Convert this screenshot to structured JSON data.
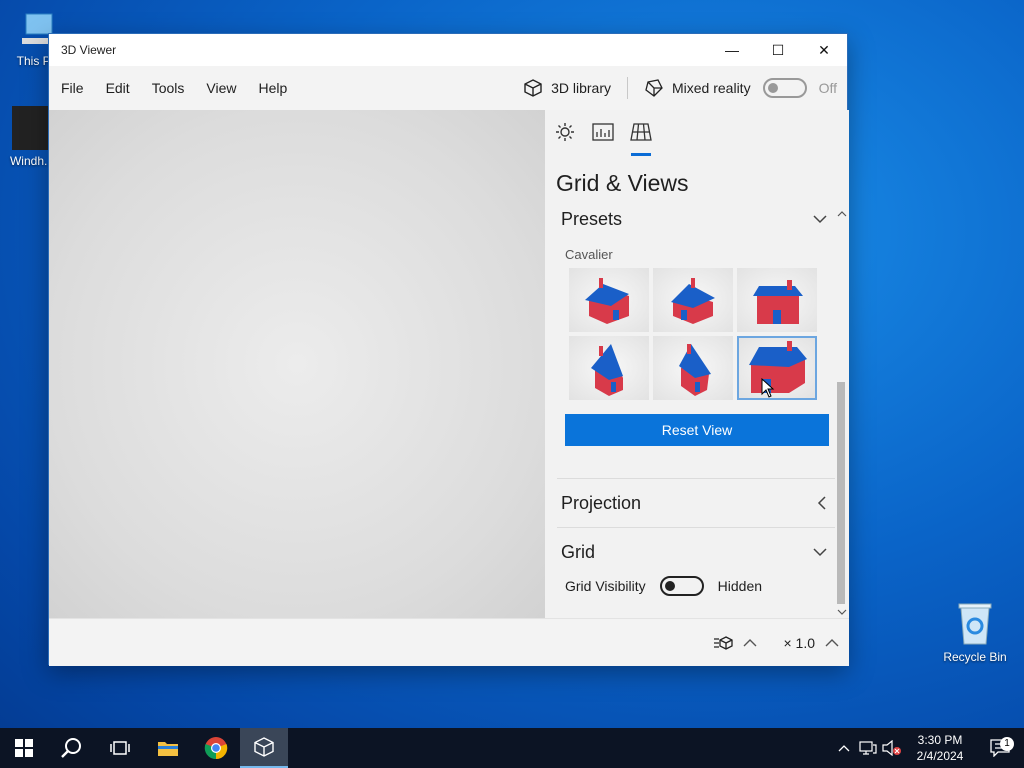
{
  "desktop": {
    "icons": [
      {
        "label": "This PC"
      },
      {
        "label": "Windh..."
      },
      {
        "label": "Recycle Bin"
      }
    ]
  },
  "window": {
    "title": "3D Viewer",
    "controls": {
      "minimize": "—",
      "maximize": "☐",
      "close": "✕"
    }
  },
  "menu": {
    "items": [
      "File",
      "Edit",
      "Tools",
      "View",
      "Help"
    ],
    "library_label": "3D library",
    "mixed_reality_label": "Mixed reality",
    "mixed_reality_state": "Off"
  },
  "panel": {
    "title": "Grid & Views",
    "presets_label": "Presets",
    "preset_group": "Cavalier",
    "reset_button": "Reset View",
    "projection_label": "Projection",
    "grid_label": "Grid",
    "grid_visibility_label": "Grid Visibility",
    "grid_visibility_state": "Hidden",
    "selected_preset_index": 5
  },
  "statusbar": {
    "zoom": "× 1.0"
  },
  "taskbar": {
    "time": "3:30 PM",
    "date": "2/4/2024",
    "notifications": "1"
  },
  "colors": {
    "accent": "#0a74da",
    "house_roof": "#1a5fc8",
    "house_wall": "#d83a4a"
  }
}
